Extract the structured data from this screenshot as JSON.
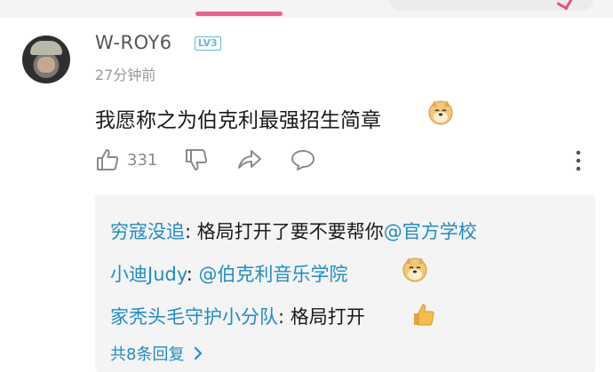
{
  "comment": {
    "username": "W-ROY6",
    "level": "LV3",
    "time": "27分钟前",
    "text": "我愿称之为伯克利最强招生简章",
    "like_count": "331"
  },
  "replies": [
    {
      "name": "穷寇没追",
      "sep": ": ",
      "text": "格局打开了要不要帮你",
      "mention": "@官方学校"
    },
    {
      "name": "小迪Judy",
      "sep": ": ",
      "text": "",
      "mention": "@伯克利音乐学院"
    },
    {
      "name": "家秃头毛守护小分队",
      "sep": ": ",
      "text": "格局打开",
      "mention": ""
    }
  ],
  "more_replies": "共8条回复",
  "icons": [
    "thumbs-up-icon",
    "thumbs-down-icon",
    "share-icon",
    "comment-icon",
    "more-vertical-icon",
    "doge-emoji",
    "thumbs-up-emoji",
    "chevron-right-icon"
  ],
  "colors": {
    "link": "#1e8dc5",
    "accent": "#f25d8e",
    "muted": "#9a9a9a"
  }
}
